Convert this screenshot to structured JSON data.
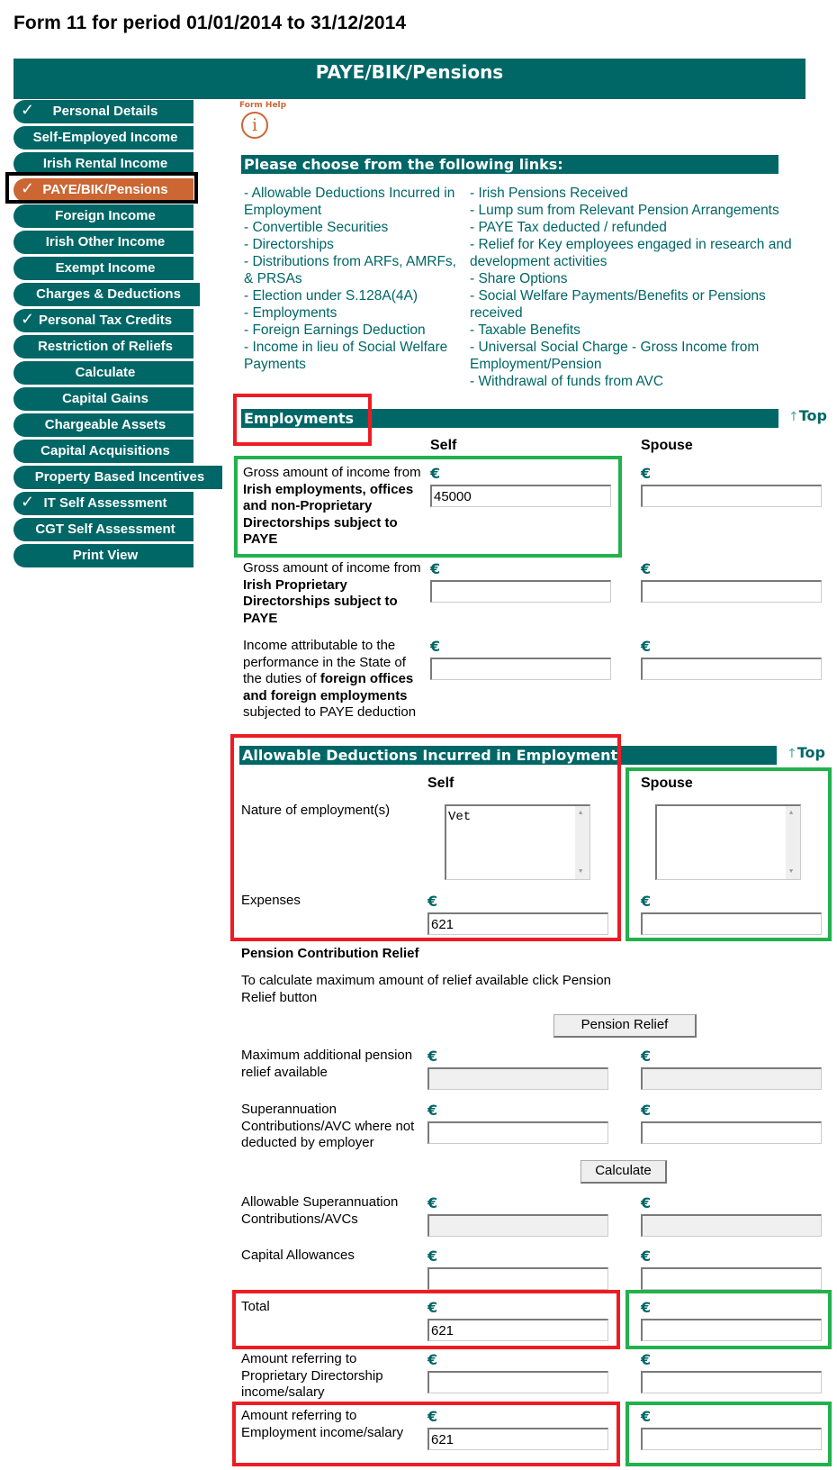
{
  "page": {
    "title": "Form 11 for period 01/01/2014 to 31/12/2014",
    "banner": "PAYE/BIK/Pensions"
  },
  "sidebar": {
    "items": [
      {
        "label": "Personal Details",
        "checked": true
      },
      {
        "label": "Self-Employed Income",
        "checked": false
      },
      {
        "label": "Irish Rental Income",
        "checked": false
      },
      {
        "label": "PAYE/BIK/Pensions",
        "checked": true,
        "active": true
      },
      {
        "label": "Foreign Income",
        "checked": false
      },
      {
        "label": "Irish Other Income",
        "checked": false
      },
      {
        "label": "Exempt Income",
        "checked": false
      },
      {
        "label": "Charges & Deductions",
        "checked": false
      },
      {
        "label": "Personal Tax Credits",
        "checked": true
      },
      {
        "label": "Restriction of Reliefs",
        "checked": false
      },
      {
        "label": "Calculate",
        "checked": false
      },
      {
        "label": "Capital Gains",
        "checked": false
      },
      {
        "label": "Chargeable Assets",
        "checked": false
      },
      {
        "label": "Capital Acquisitions",
        "checked": false
      },
      {
        "label": "Property Based Incentives",
        "checked": false
      },
      {
        "label": "IT Self Assessment",
        "checked": true
      },
      {
        "label": "CGT Self Assessment",
        "checked": false
      },
      {
        "label": "Print View",
        "checked": false
      }
    ],
    "check_glyph": "✓"
  },
  "help": {
    "label": "Form Help",
    "icon": "info-icon",
    "glyph": "i"
  },
  "links": {
    "heading": "Please choose from the following links:",
    "col_a": [
      "- Allowable Deductions Incurred in Employment",
      "- Convertible Securities",
      "- Directorships",
      "- Distributions from ARFs, AMRFs, & PRSAs",
      "- Election under S.128A(4A)",
      "- Employments",
      "- Foreign Earnings Deduction",
      "- Income in lieu of Social Welfare Payments"
    ],
    "col_b": [
      "- Irish Pensions Received",
      "- Lump sum from Relevant Pension Arrangements",
      "- PAYE Tax deducted / refunded",
      "- Relief for Key employees engaged in research and development activities",
      "- Share Options",
      "- Social Welfare Payments/Benefits or Pensions received",
      "- Taxable Benefits",
      "- Universal Social Charge - Gross Income from Employment/Pension",
      "- Withdrawal of funds from AVC"
    ]
  },
  "common": {
    "top_link": "Top",
    "top_arrow": "↑",
    "self": "Self",
    "spouse": "Spouse",
    "currency": "€"
  },
  "employments": {
    "heading": "Employments",
    "rows": [
      {
        "label_pre": "Gross amount of income from ",
        "label_bold": "Irish employments, offices and non-Proprietary Directorships subject to PAYE",
        "label_post": "",
        "self": "45000",
        "spouse": ""
      },
      {
        "label_pre": "Gross amount of income from ",
        "label_bold": "Irish Proprietary Directorships subject to PAYE",
        "label_post": "",
        "self": "",
        "spouse": ""
      },
      {
        "label_pre": "Income attributable to the performance in the State of the duties of ",
        "label_bold": "foreign offices and foreign employments",
        "label_post": " subjected to PAYE deduction",
        "self": "",
        "spouse": ""
      }
    ]
  },
  "deductions": {
    "heading": "Allowable Deductions Incurred in Employment",
    "nature_label": "Nature of employment(s)",
    "nature_self": "Vet",
    "nature_spouse": "",
    "expenses_label": "Expenses",
    "expenses_self": "621",
    "expenses_spouse": "",
    "pension_heading": "Pension Contribution Relief",
    "pension_note": "To calculate maximum amount of relief available click Pension Relief button",
    "pension_button": "Pension Relief",
    "max_relief_label": "Maximum additional pension relief available",
    "max_relief_self": "",
    "max_relief_spouse": "",
    "superann_label": "Superannuation Contributions/AVC where not deducted by employer",
    "superann_self": "",
    "superann_spouse": "",
    "calculate_button": "Calculate",
    "allowable_label": "Allowable Superannuation Contributions/AVCs",
    "allowable_self": "",
    "allowable_spouse": "",
    "capital_label": "Capital Allowances",
    "capital_self": "",
    "capital_spouse": "",
    "total_label": "Total",
    "total_self": "621",
    "total_spouse": "",
    "prop_dir_label": "Amount referring to Proprietary Directorship income/salary",
    "prop_dir_self": "",
    "prop_dir_spouse": "",
    "emp_label": "Amount referring to Employment income/salary",
    "emp_self": "621",
    "emp_spouse": ""
  },
  "colors": {
    "teal": "#006666",
    "orange": "#cc6633",
    "annotation_red": "#ed1c24",
    "annotation_green": "#22b14c"
  }
}
